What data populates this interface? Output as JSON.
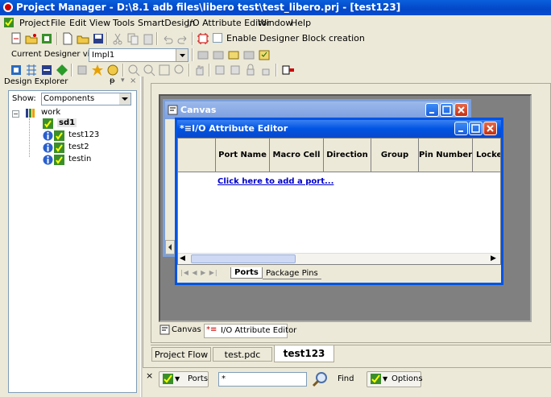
{
  "window": {
    "title": "Project Manager - D:\\8.1 adb files\\libero test\\test_libero.prj - [test123]"
  },
  "menu": [
    "Project",
    "File",
    "Edit",
    "View",
    "Tools",
    "SmartDesign",
    "I/O Attribute Editor",
    "Window",
    "Help"
  ],
  "toolbar": {
    "enable_designer_label": "Enable Designer Block creation",
    "current_view_label": "Current Designer view:",
    "current_view_value": "Impl1"
  },
  "explorer": {
    "title": "Design Explorer",
    "show_label": "Show:",
    "show_value": "Components",
    "tree": {
      "root": "work",
      "items": [
        "sd1",
        "test123",
        "test2",
        "testin"
      ]
    }
  },
  "canvas_window": {
    "title": "Canvas"
  },
  "io_editor": {
    "title": "I/O Attribute Editor",
    "columns": [
      "Port Name",
      "Macro Cell",
      "Direction",
      "Group",
      "Pin Number",
      "Locked"
    ],
    "add_port_link": "Click here to add a port...",
    "tabs": [
      "Ports",
      "Package Pins"
    ]
  },
  "mdi_tabs": [
    "Canvas",
    "I/O Attribute Editor"
  ],
  "doc_tabs": [
    "Project Flow",
    "test.pdc",
    "test123"
  ],
  "bottom": {
    "ports_label": "Ports",
    "search_value": "*",
    "find_label": "Find",
    "options_label": "Options"
  }
}
